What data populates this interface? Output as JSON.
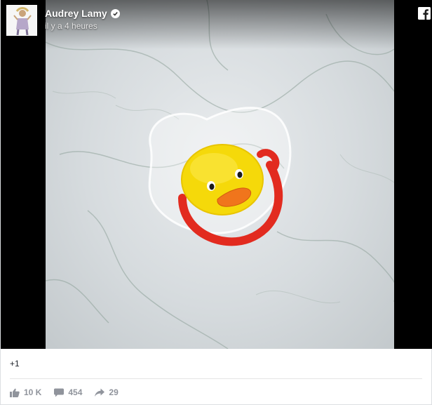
{
  "post": {
    "author": {
      "name": "Audrey Lamy",
      "verified": true,
      "avatar_icon": "profile-photo"
    },
    "timestamp": "il y a 4 heures",
    "platform_icon": "facebook-logo-icon",
    "caption": "+1",
    "stats": {
      "likes": "10 K",
      "comments": "454",
      "shares": "29"
    },
    "colors": {
      "brand": "#3b5998",
      "stat_text": "#90949c",
      "pacifier_ring": "#e22b1f",
      "pacifier_button": "#f5d90a"
    }
  }
}
